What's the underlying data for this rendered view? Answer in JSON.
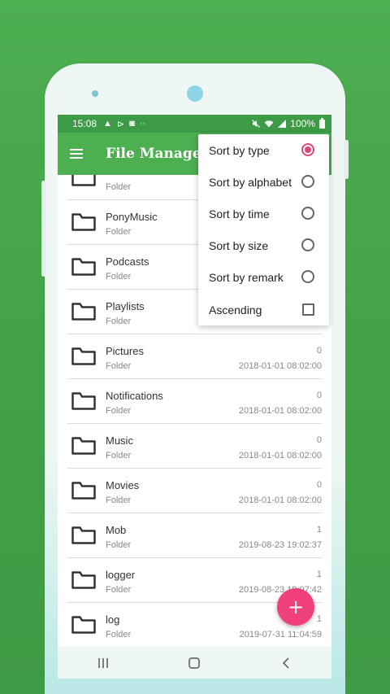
{
  "status_bar": {
    "time": "15:08",
    "left_icons": [
      "▲",
      "⊳",
      "◙",
      "··"
    ],
    "right_icons": [
      "🔇",
      "wifi",
      "signal"
    ],
    "battery": "100%"
  },
  "app_bar": {
    "title": "File Manager"
  },
  "files": [
    {
      "name": "",
      "type": "Folder",
      "count": "",
      "date": ""
    },
    {
      "name": "PonyMusic",
      "type": "Folder",
      "count": "",
      "date": ""
    },
    {
      "name": "Podcasts",
      "type": "Folder",
      "count": "",
      "date": ""
    },
    {
      "name": "Playlists",
      "type": "Folder",
      "count": "",
      "date": ""
    },
    {
      "name": "Pictures",
      "type": "Folder",
      "count": "0",
      "date": "2018-01-01 08:02:00"
    },
    {
      "name": "Notifications",
      "type": "Folder",
      "count": "0",
      "date": "2018-01-01 08:02:00"
    },
    {
      "name": "Music",
      "type": "Folder",
      "count": "0",
      "date": "2018-01-01 08:02:00"
    },
    {
      "name": "Movies",
      "type": "Folder",
      "count": "0",
      "date": "2018-01-01 08:02:00"
    },
    {
      "name": "Mob",
      "type": "Folder",
      "count": "1",
      "date": "2019-08-23 19:02:37"
    },
    {
      "name": "logger",
      "type": "Folder",
      "count": "1",
      "date": "2019-08-23 19:07:42"
    },
    {
      "name": "log",
      "type": "Folder",
      "count": "1",
      "date": "2019-07-31 11:04:59"
    }
  ],
  "sort_menu": {
    "items": [
      {
        "label": "Sort by type",
        "control": "radio",
        "checked": true
      },
      {
        "label": "Sort by alphabet",
        "control": "radio",
        "checked": false
      },
      {
        "label": "Sort by time",
        "control": "radio",
        "checked": false
      },
      {
        "label": "Sort by size",
        "control": "radio",
        "checked": false
      },
      {
        "label": "Sort by remark",
        "control": "radio",
        "checked": false
      },
      {
        "label": "Ascending",
        "control": "checkbox",
        "checked": false
      }
    ]
  },
  "fab": {
    "label": "+"
  },
  "colors": {
    "primary": "#4caf50",
    "status_bar": "#3d9a47",
    "accent": "#f0417a"
  }
}
